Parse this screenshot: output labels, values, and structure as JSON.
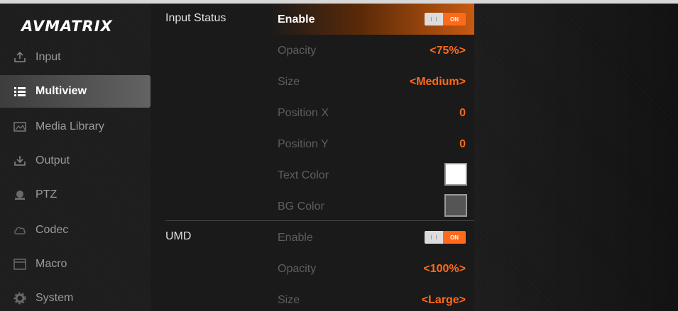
{
  "brand": {
    "logo_text": "AVMATRIX"
  },
  "sidebar": {
    "items": [
      {
        "label": "Input",
        "icon": "upload-icon",
        "active": false
      },
      {
        "label": "Multiview",
        "icon": "list-icon",
        "active": true
      },
      {
        "label": "Media Library",
        "icon": "image-icon",
        "active": false
      },
      {
        "label": "Output",
        "icon": "download-icon",
        "active": false
      },
      {
        "label": "PTZ",
        "icon": "camera-icon",
        "active": false
      },
      {
        "label": "Codec",
        "icon": "cloud-icon",
        "active": false
      },
      {
        "label": "Macro",
        "icon": "window-icon",
        "active": false
      },
      {
        "label": "System",
        "icon": "gear-icon",
        "active": false
      }
    ]
  },
  "settings": {
    "input_status": {
      "group_label": "Input Status",
      "enable": {
        "label": "Enable",
        "state": "ON"
      },
      "opacity": {
        "label": "Opacity",
        "value": "<75%>"
      },
      "size": {
        "label": "Size",
        "value": "<Medium>"
      },
      "position_x": {
        "label": "Position X",
        "value": "0"
      },
      "position_y": {
        "label": "Position Y",
        "value": "0"
      },
      "text_color": {
        "label": "Text Color",
        "color": "#ffffff"
      },
      "bg_color": {
        "label": "BG Color",
        "color": "#555555"
      }
    },
    "umd": {
      "group_label": "UMD",
      "enable": {
        "label": "Enable",
        "state": "ON"
      },
      "opacity": {
        "label": "Opacity",
        "value": "<100%>"
      },
      "size": {
        "label": "Size",
        "value": "<Large>"
      }
    }
  },
  "colors": {
    "accent": "#ff6a1a",
    "background": "#1a1a1a"
  }
}
